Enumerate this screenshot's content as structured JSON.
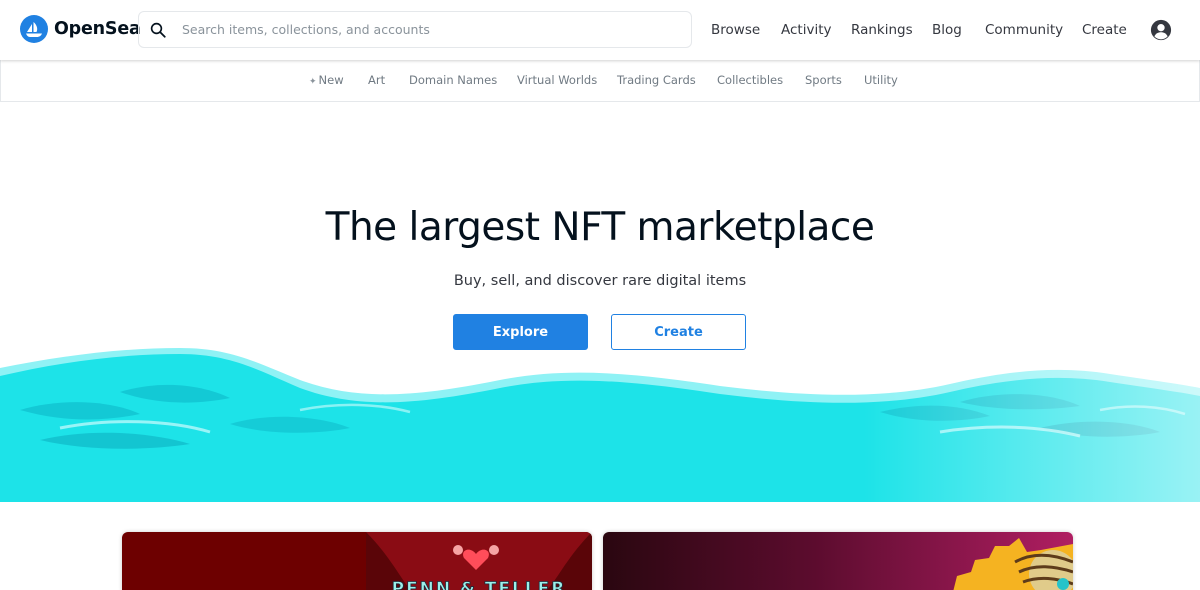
{
  "brand": {
    "name": "OpenSea",
    "logo_icon": "opensea-sailboat-icon",
    "accent_color": "#2081e2"
  },
  "search": {
    "placeholder": "Search items, collections, and accounts",
    "value": "",
    "icon": "search-icon"
  },
  "nav": {
    "items": [
      {
        "label": "Browse"
      },
      {
        "label": "Activity"
      },
      {
        "label": "Rankings"
      },
      {
        "label": "Blog"
      },
      {
        "label": "Community"
      },
      {
        "label": "Create"
      }
    ],
    "account_icon": "account-circle-icon"
  },
  "categories": {
    "items": [
      {
        "label": "New",
        "icon": "sparkle-icon"
      },
      {
        "label": "Art"
      },
      {
        "label": "Domain Names"
      },
      {
        "label": "Virtual Worlds"
      },
      {
        "label": "Trading Cards"
      },
      {
        "label": "Collectibles"
      },
      {
        "label": "Sports"
      },
      {
        "label": "Utility"
      }
    ]
  },
  "hero": {
    "title": "The largest NFT marketplace",
    "subtitle": "Buy, sell, and discover rare digital items",
    "primary_button": "Explore",
    "secondary_button": "Create",
    "wave_color": "#1de3e8"
  },
  "featured": {
    "cards": [
      {
        "art_text": "PENN & TELLER",
        "art_icon": "heart-card-suit-icon"
      },
      {
        "art_icon": "cartoon-art-icon"
      }
    ]
  }
}
